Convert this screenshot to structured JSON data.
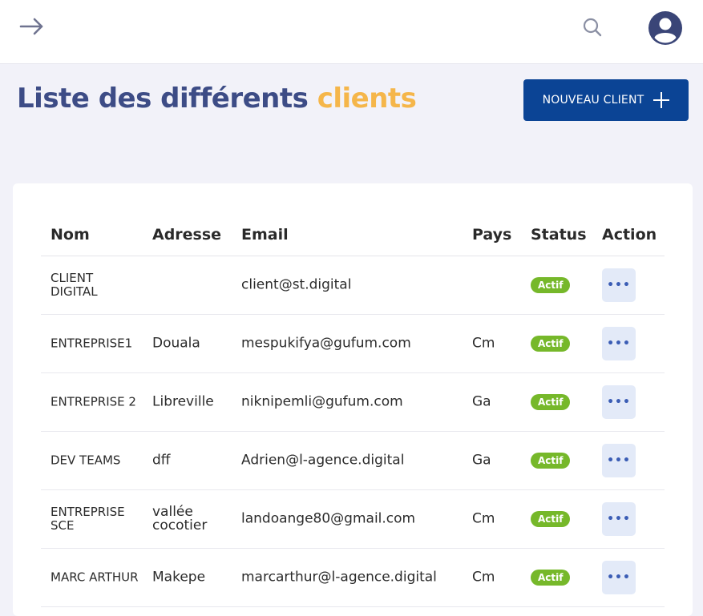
{
  "header": {
    "menu_toggle_icon": "arrow-right-icon",
    "search_icon": "search-icon",
    "avatar_icon": "user-avatar-icon"
  },
  "title": {
    "main": "Liste des différents ",
    "accent": "clients"
  },
  "new_client_button": {
    "label": "NOUVEAU CLIENT",
    "icon": "plus-icon"
  },
  "colors": {
    "brand": "#0b4495",
    "title": "#3d4c86",
    "accent": "#f5b64a",
    "status_active": "#76b82a",
    "action_bg": "#e3eaf8"
  },
  "table": {
    "columns": [
      "Nom",
      "Adresse",
      "Email",
      "Pays",
      "Status",
      "Action"
    ],
    "rows": [
      {
        "nom": "CLIENT DIGITAL",
        "adresse": "",
        "email": "client@st.digital",
        "pays": "",
        "status": "Actif",
        "action": "•••"
      },
      {
        "nom": "ENTREPRISE1",
        "adresse": "Douala",
        "email": "mespukifya@gufum.com",
        "pays": "Cm",
        "status": "Actif",
        "action": "•••"
      },
      {
        "nom": "ENTREPRISE 2",
        "adresse": "Libreville",
        "email": "niknipemli@gufum.com",
        "pays": "Ga",
        "status": "Actif",
        "action": "•••"
      },
      {
        "nom": "DEV TEAMS",
        "adresse": "dff",
        "email": "Adrien@l-agence.digital",
        "pays": "Ga",
        "status": "Actif",
        "action": "•••"
      },
      {
        "nom": "ENTREPRISE SCE",
        "adresse": "vallée cocotier",
        "email": "landoange80@gmail.com",
        "pays": "Cm",
        "status": "Actif",
        "action": "•••"
      },
      {
        "nom": "MARC ARTHUR",
        "adresse": "Makepe",
        "email": "marcarthur@l-agence.digital",
        "pays": "Cm",
        "status": "Actif",
        "action": "•••"
      }
    ]
  }
}
